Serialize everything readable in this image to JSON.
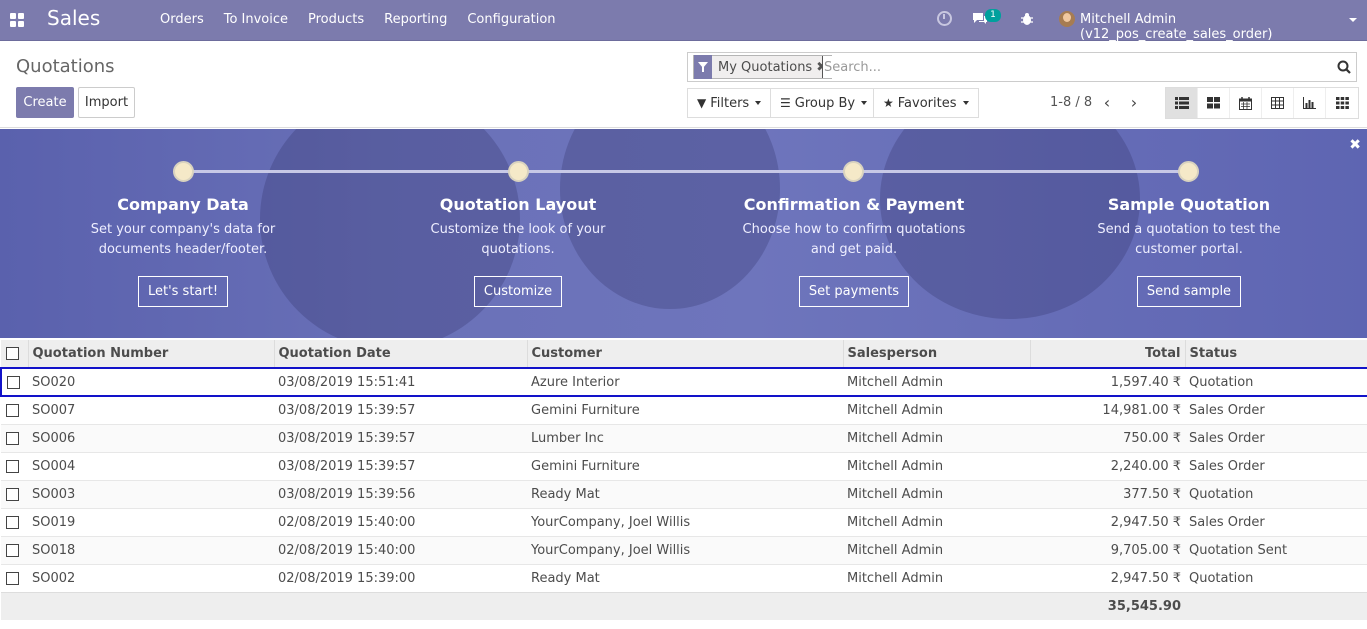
{
  "navbar": {
    "app_title": "Sales",
    "menu": [
      "Orders",
      "To Invoice",
      "Products",
      "Reporting",
      "Configuration"
    ],
    "chat_badge": "1",
    "user_name": "Mitchell Admin (v12_pos_create_sales_order)"
  },
  "control_panel": {
    "breadcrumb": "Quotations",
    "create_label": "Create",
    "import_label": "Import",
    "facet_label": "My Quotations",
    "search_placeholder": "Search...",
    "filters_label": "Filters",
    "groupby_label": "Group By",
    "favorites_label": "Favorites",
    "pager": "1-8 / 8"
  },
  "banner": {
    "steps": [
      {
        "title": "Company Data",
        "desc1": "Set your company's data for",
        "desc2": "documents header/footer.",
        "button": "Let's start!"
      },
      {
        "title": "Quotation Layout",
        "desc1": "Customize the look of your",
        "desc2": "quotations.",
        "button": "Customize"
      },
      {
        "title": "Confirmation & Payment",
        "desc1": "Choose how to confirm quotations",
        "desc2": "and get paid.",
        "button": "Set payments"
      },
      {
        "title": "Sample Quotation",
        "desc1": "Send a quotation to test the",
        "desc2": "customer portal.",
        "button": "Send sample"
      }
    ]
  },
  "table": {
    "headers": [
      "Quotation Number",
      "Quotation Date",
      "Customer",
      "Salesperson",
      "Total",
      "Status"
    ],
    "rows": [
      {
        "number": "SO020",
        "date": "03/08/2019 15:51:41",
        "customer": "Azure Interior",
        "salesperson": "Mitchell Admin",
        "total": "1,597.40 ₹",
        "status": "Quotation"
      },
      {
        "number": "SO007",
        "date": "03/08/2019 15:39:57",
        "customer": "Gemini Furniture",
        "salesperson": "Mitchell Admin",
        "total": "14,981.00 ₹",
        "status": "Sales Order"
      },
      {
        "number": "SO006",
        "date": "03/08/2019 15:39:57",
        "customer": "Lumber Inc",
        "salesperson": "Mitchell Admin",
        "total": "750.00 ₹",
        "status": "Sales Order"
      },
      {
        "number": "SO004",
        "date": "03/08/2019 15:39:57",
        "customer": "Gemini Furniture",
        "salesperson": "Mitchell Admin",
        "total": "2,240.00 ₹",
        "status": "Sales Order"
      },
      {
        "number": "SO003",
        "date": "03/08/2019 15:39:56",
        "customer": "Ready Mat",
        "salesperson": "Mitchell Admin",
        "total": "377.50 ₹",
        "status": "Quotation"
      },
      {
        "number": "SO019",
        "date": "02/08/2019 15:40:00",
        "customer": "YourCompany, Joel Willis",
        "salesperson": "Mitchell Admin",
        "total": "2,947.50 ₹",
        "status": "Sales Order"
      },
      {
        "number": "SO018",
        "date": "02/08/2019 15:40:00",
        "customer": "YourCompany, Joel Willis",
        "salesperson": "Mitchell Admin",
        "total": "9,705.00 ₹",
        "status": "Quotation Sent"
      },
      {
        "number": "SO002",
        "date": "02/08/2019 15:39:00",
        "customer": "Ready Mat",
        "salesperson": "Mitchell Admin",
        "total": "2,947.50 ₹",
        "status": "Quotation"
      }
    ],
    "footer_total": "35,545.90"
  },
  "colors": {
    "brand": "#7c7bad",
    "highlight_border": "#1212c9"
  }
}
